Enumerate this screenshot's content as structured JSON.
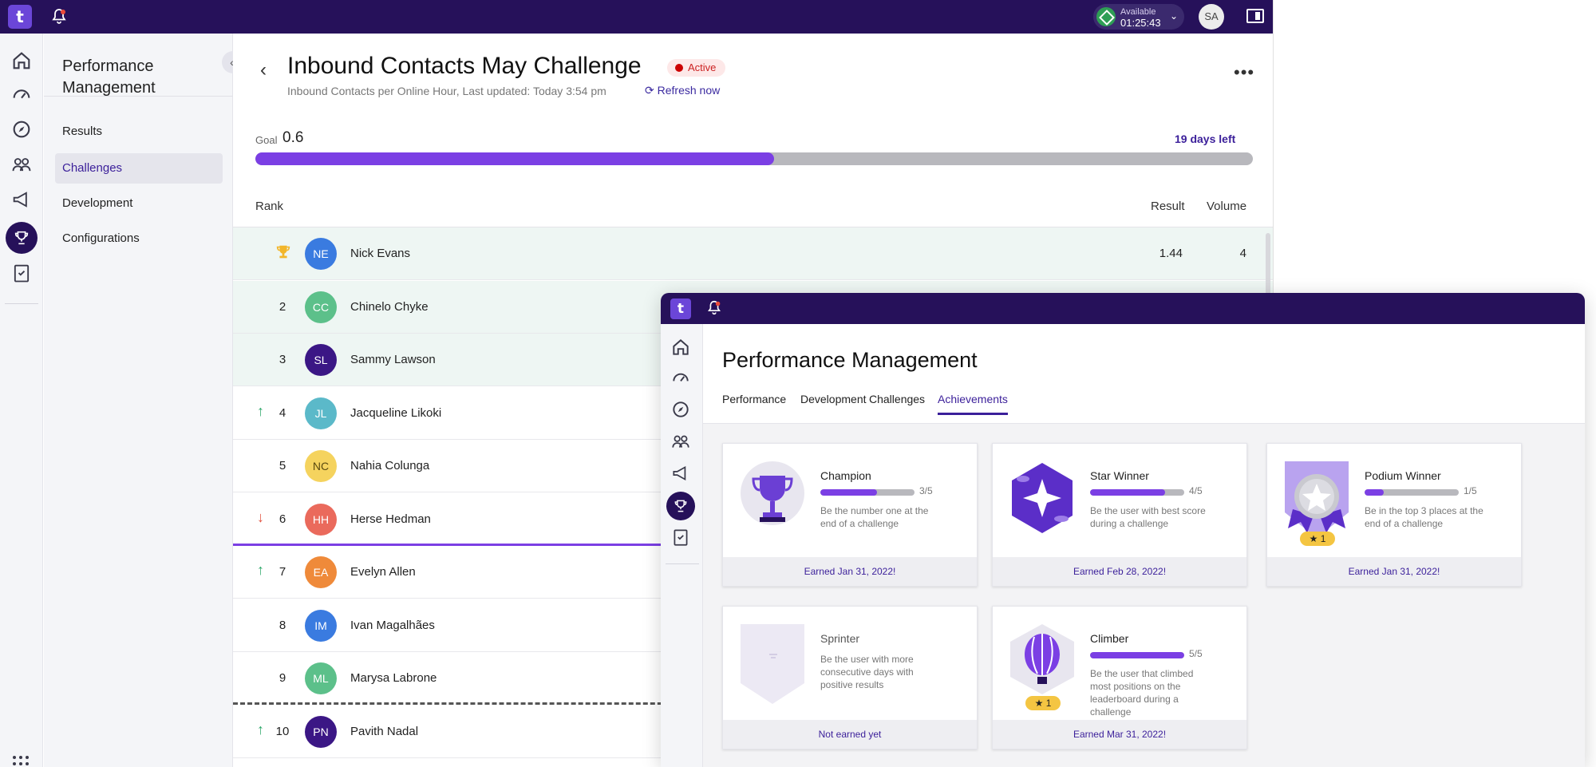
{
  "app": {
    "availability": {
      "label": "Available",
      "time": "01:25:43"
    },
    "user_initials": "SA"
  },
  "sidenav": {
    "title": "Performance Management",
    "items": [
      {
        "label": "Results",
        "active": false
      },
      {
        "label": "Challenges",
        "active": true
      },
      {
        "label": "Development",
        "active": false
      },
      {
        "label": "Configurations",
        "active": false
      }
    ]
  },
  "challenge": {
    "title": "Inbound Contacts May Challenge",
    "status": "Active",
    "subtitle": "Inbound Contacts per Online Hour, Last updated: Today 3:54 pm",
    "refresh_label": "Refresh now",
    "goal_label": "Goal",
    "goal_value": "0.6",
    "days_left": "19 days left",
    "progress_fraction": 0.52
  },
  "leaderboard": {
    "headers": {
      "rank": "Rank",
      "result": "Result",
      "volume": "Volume"
    },
    "rows": [
      {
        "rank": "",
        "trophy": true,
        "trend": "",
        "initials": "NE",
        "color": "#3a7be0",
        "name": "Nick Evans",
        "result": "1.44",
        "volume": "4"
      },
      {
        "rank": "2",
        "trend": "",
        "initials": "CC",
        "color": "#5cc08a",
        "name": "Chinelo Chyke"
      },
      {
        "rank": "3",
        "trend": "",
        "initials": "SL",
        "color": "#3b1785",
        "name": "Sammy Lawson"
      },
      {
        "rank": "4",
        "trend": "up",
        "initials": "JL",
        "color": "#5bb9c9",
        "name": "Jacqueline Likoki"
      },
      {
        "rank": "5",
        "trend": "",
        "initials": "NC",
        "color": "#f5d35e",
        "name": "Nahia Colunga"
      },
      {
        "rank": "6",
        "trend": "down",
        "initials": "HH",
        "color": "#ea6a5c",
        "name": "Herse Hedman"
      },
      {
        "rank": "7",
        "trend": "up",
        "initials": "EA",
        "color": "#ef8a3a",
        "name": "Evelyn Allen"
      },
      {
        "rank": "8",
        "trend": "",
        "initials": "IM",
        "color": "#3a7be0",
        "name": "Ivan Magalhães"
      },
      {
        "rank": "9",
        "trend": "",
        "initials": "ML",
        "color": "#5cc08a",
        "name": "Marysa Labrone"
      },
      {
        "rank": "10",
        "trend": "up",
        "initials": "PN",
        "color": "#3b1785",
        "name": "Pavith Nadal"
      }
    ]
  },
  "overlay": {
    "title": "Performance Management",
    "tabs": [
      {
        "label": "Performance",
        "active": false
      },
      {
        "label": "Development",
        "active": false
      },
      {
        "label": "Challenges",
        "active": false
      },
      {
        "label": "Achievements",
        "active": true
      }
    ],
    "achievements": [
      {
        "name": "Champion",
        "count": "3/5",
        "progress": 0.6,
        "desc": "Be the number one at the end of a challenge",
        "footer": "Earned Jan 31, 2022!",
        "icon": "trophy-icon"
      },
      {
        "name": "Star Winner",
        "count": "4/5",
        "progress": 0.8,
        "desc": "Be the user with best score during a challenge",
        "footer": "Earned Feb 28, 2022!",
        "icon": "star-hexagon-icon"
      },
      {
        "name": "Podium Winner",
        "count": "1/5",
        "progress": 0.2,
        "desc": "Be in the top 3 places at the end of a challenge",
        "footer": "Earned Jan 31, 2022!",
        "icon": "medal-icon",
        "badge": "★ 1"
      },
      {
        "name": "Sprinter",
        "count": "",
        "progress": null,
        "desc": "Be the user with more consecutive days with positive results",
        "footer": "Not earned yet",
        "icon": "sprinter-shield-icon"
      },
      {
        "name": "Climber",
        "count": "5/5",
        "progress": 1.0,
        "desc": "Be the user that climbed most positions on the leaderboard during a challenge",
        "footer": "Earned Mar 31, 2022!",
        "icon": "balloon-icon",
        "badge": "★ 1"
      }
    ]
  },
  "colors": {
    "brand": "#26115a",
    "accent": "#7b3fe4",
    "link": "#3b1f9a"
  }
}
